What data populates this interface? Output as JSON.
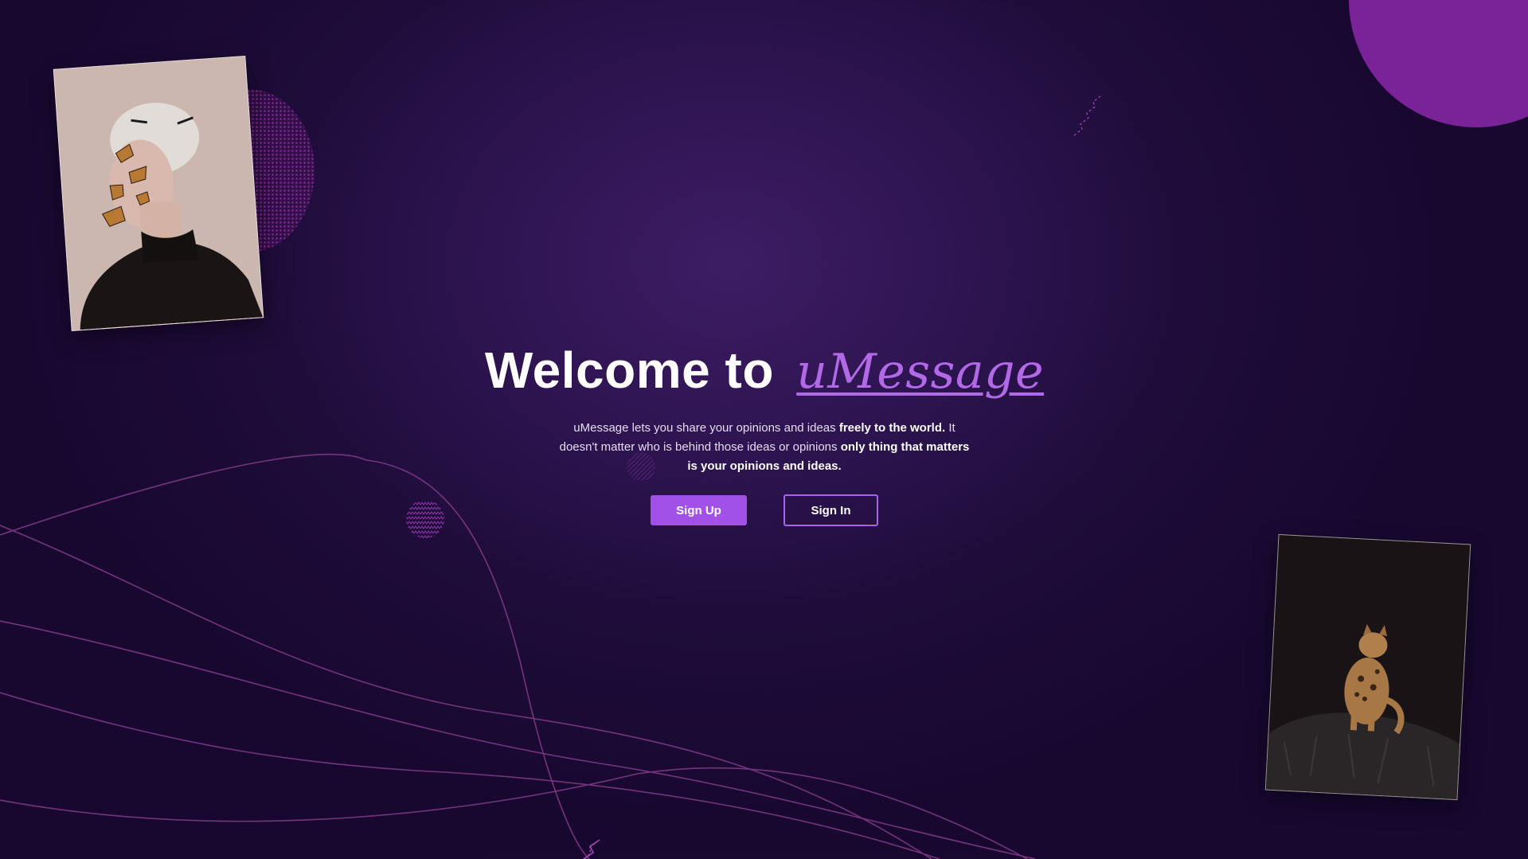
{
  "hero": {
    "title_prefix": "Welcome to",
    "brand_name": "uMessage",
    "description": {
      "part1": "uMessage lets you share your opinions and ideas ",
      "bold1": "freely to the world.",
      "part2": " It doesn't matter who is behind those ideas or opinions ",
      "bold2": "only thing that matters is your opinions and ideas."
    }
  },
  "buttons": {
    "sign_up": "Sign Up",
    "sign_in": "Sign In"
  },
  "colors": {
    "background": "#2a1248",
    "accent": "#a150e8",
    "brand": "#b169e6",
    "corner_circle": "#7a2298",
    "lines": "#8a3f8e"
  },
  "images": {
    "left_photo": "portrait of person with butterflies on face",
    "right_photo": "bengal cat sitting on black fur"
  }
}
